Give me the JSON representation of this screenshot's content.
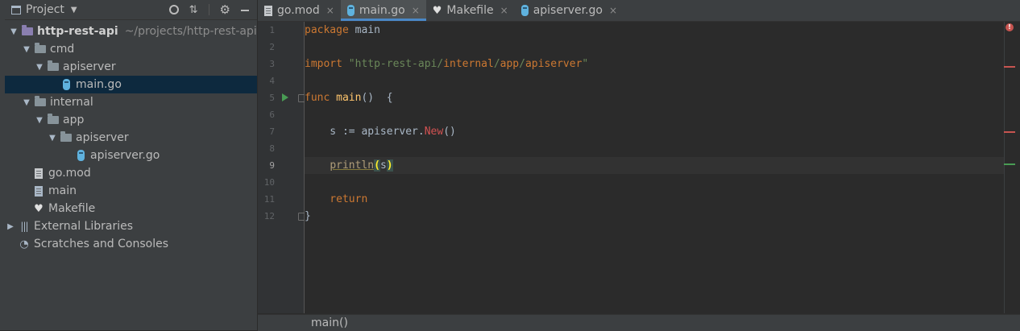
{
  "project_panel": {
    "title": "Project",
    "tools": [
      "locate-icon",
      "collapse-icon",
      "settings-icon",
      "hide-icon"
    ],
    "tree": [
      {
        "label": "http-rest-api",
        "path": "~/projects/http-rest-api"
      },
      {
        "label": "cmd"
      },
      {
        "label": "apiserver"
      },
      {
        "label": "main.go"
      },
      {
        "label": "internal"
      },
      {
        "label": "app"
      },
      {
        "label": "apiserver"
      },
      {
        "label": "apiserver.go"
      },
      {
        "label": "go.mod"
      },
      {
        "label": "main"
      },
      {
        "label": "Makefile"
      },
      {
        "label": "External Libraries"
      },
      {
        "label": "Scratches and Consoles"
      }
    ]
  },
  "tabs": [
    {
      "label": "go.mod",
      "close": "×"
    },
    {
      "label": "main.go",
      "close": "×"
    },
    {
      "label": "Makefile",
      "close": "×"
    },
    {
      "label": "apiserver.go",
      "close": "×"
    }
  ],
  "editor": {
    "line_numbers": [
      "1",
      "2",
      "3",
      "4",
      "5",
      "6",
      "7",
      "8",
      "9",
      "10",
      "11",
      "12"
    ],
    "code": {
      "l1_kw": "package",
      "l1_id": " main",
      "l3_kw": "import",
      "l3_str_open": " \"http-rest-api/",
      "l3_internal": "internal",
      "l3_slash1": "/",
      "l3_app": "app",
      "l3_slash2": "/",
      "l3_apiserver": "apiserver",
      "l3_str_close": "\"",
      "l5_kw": "func",
      "l5_fn": " main",
      "l5_rest": "()  {",
      "l7_a": "    s := apiserver.",
      "l7_new": "New",
      "l7_b": "()",
      "l9_indent": "    ",
      "l9_fn": "println",
      "l9_open": "(",
      "l9_arg": "s",
      "l9_close": ")",
      "l11_kw": "    return",
      "l12": "}"
    },
    "error_indicator": "!"
  },
  "breadcrumb": {
    "text": "main()"
  },
  "colors": {
    "accent": "#4a88c7",
    "error": "#c75450",
    "run": "#499c54"
  }
}
